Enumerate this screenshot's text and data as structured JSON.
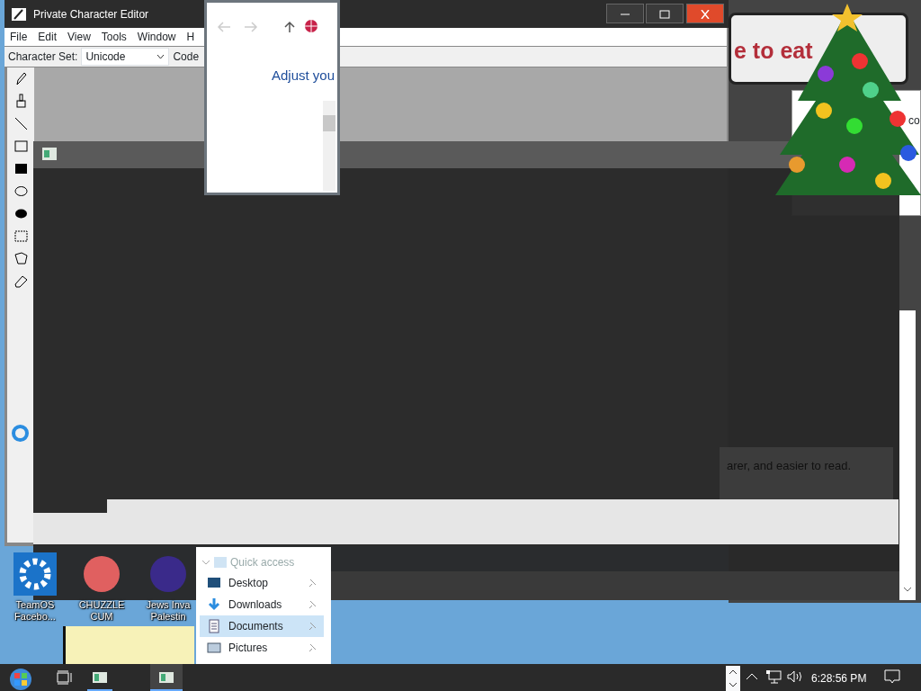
{
  "editor_window": {
    "title": "Private Character Editor",
    "menu": [
      "File",
      "Edit",
      "View",
      "Tools",
      "Window",
      "H"
    ],
    "toolbar": {
      "character_set_label": "Character Set:",
      "character_set_value": "Unicode",
      "code_label": "Code"
    },
    "tools": [
      {
        "kind": "pencil"
      },
      {
        "kind": "brush"
      },
      {
        "kind": "line"
      },
      {
        "kind": "hollow-rect"
      },
      {
        "kind": "filled-rect"
      },
      {
        "kind": "hollow-ellipse"
      },
      {
        "kind": "filled-ellipse"
      },
      {
        "kind": "rect-select"
      },
      {
        "kind": "freeform-select"
      },
      {
        "kind": "eraser"
      }
    ]
  },
  "explorer_popup": {
    "heading": "Adjust you"
  },
  "background_window": {
    "banner": "e to eat",
    "fragment": "co",
    "caption": "arer, and easier to read."
  },
  "desktop_icons": [
    {
      "kind": "gear",
      "lines": [
        "TeamOS",
        "Facebo..."
      ]
    },
    {
      "kind": "red",
      "lines": [
        "CHUZZLE",
        "CUM"
      ]
    },
    {
      "kind": "purple",
      "lines": [
        "Jews Inva",
        "Palestin"
      ]
    }
  ],
  "quick_access": {
    "heading": "Quick access",
    "items": [
      {
        "kind": "desktop",
        "label": "Desktop",
        "selected": false
      },
      {
        "kind": "downloads",
        "label": "Downloads",
        "selected": false
      },
      {
        "kind": "documents",
        "label": "Documents",
        "selected": true
      },
      {
        "kind": "pictures",
        "label": "Pictures",
        "selected": false
      }
    ]
  },
  "taskbar": {
    "clock": "6:28:56 PM"
  }
}
